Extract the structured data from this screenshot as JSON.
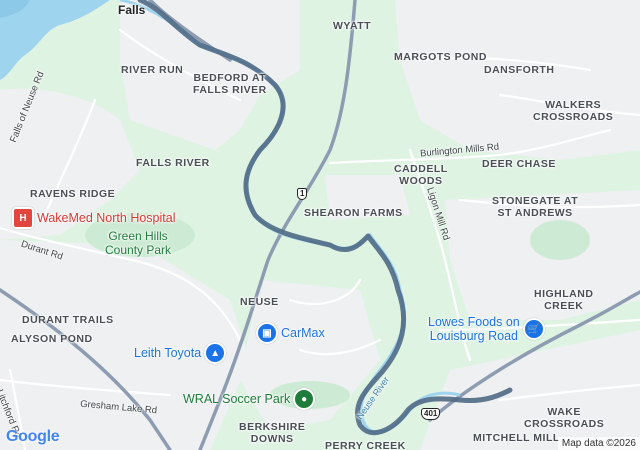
{
  "map": {
    "place_labels": [
      {
        "id": "falls",
        "text": "Falls"
      },
      {
        "id": "wyatt",
        "text": "WYATT"
      },
      {
        "id": "margots-pond",
        "text": "MARGOTS POND"
      },
      {
        "id": "dansforth",
        "text": "DANSFORTH"
      },
      {
        "id": "river-run",
        "text": "RIVER RUN"
      },
      {
        "id": "bedford",
        "text": "BEDFORD AT\nFALLS RIVER"
      },
      {
        "id": "walkers-crossroads",
        "text": "WALKERS\nCROSSROADS"
      },
      {
        "id": "caddell-woods",
        "text": "CADDELL\nWOODS"
      },
      {
        "id": "deer-chase",
        "text": "DEER CHASE"
      },
      {
        "id": "falls-river",
        "text": "FALLS RIVER"
      },
      {
        "id": "ravens-ridge",
        "text": "RAVENS RIDGE"
      },
      {
        "id": "shearon-farms",
        "text": "SHEARON FARMS"
      },
      {
        "id": "stonegate",
        "text": "STONEGATE AT\nST ANDREWS"
      },
      {
        "id": "highland-creek",
        "text": "HIGHLAND\nCREEK"
      },
      {
        "id": "neuse",
        "text": "NEUSE"
      },
      {
        "id": "durant-trails",
        "text": "DURANT TRAILS"
      },
      {
        "id": "alyson-pond",
        "text": "ALYSON POND"
      },
      {
        "id": "berkshire-downs",
        "text": "BERKSHIRE\nDOWNS"
      },
      {
        "id": "perry-creek",
        "text": "PERRY CREEK"
      },
      {
        "id": "wake-crossroads",
        "text": "WAKE\nCROSSROADS"
      },
      {
        "id": "mitchell-mill",
        "text": "MITCHELL MILL"
      }
    ],
    "road_labels": [
      {
        "id": "falls-of-neuse",
        "text": "Falls of Neuse Rd"
      },
      {
        "id": "burlington-mills",
        "text": "Burlington Mills Rd"
      },
      {
        "id": "ligon-mill",
        "text": "Ligon Mill Rd"
      },
      {
        "id": "durant",
        "text": "Durant Rd"
      },
      {
        "id": "gresham-lake",
        "text": "Gresham Lake Rd"
      },
      {
        "id": "litchford",
        "text": "Litchford Rd"
      }
    ],
    "water_labels": [
      {
        "id": "neuse-river",
        "text": "Neuse River"
      }
    ],
    "park_labels": [
      {
        "id": "green-hills",
        "text": "Green Hills\nCounty Park"
      }
    ],
    "route_shields": [
      {
        "id": "us1",
        "text": "1"
      },
      {
        "id": "us401",
        "text": "401"
      }
    ],
    "pois": [
      {
        "id": "wakemed",
        "text": "WakeMed North Hospital",
        "icon": "hospital-icon",
        "color": "#e2463f"
      },
      {
        "id": "carmax",
        "text": "CarMax",
        "icon": "shopping-bag-icon",
        "color": "#1a73e8"
      },
      {
        "id": "leith-toyota",
        "text": "Leith Toyota",
        "icon": "car-dealer-icon",
        "color": "#1a73e8"
      },
      {
        "id": "lowes-foods",
        "text": "Lowes Foods on\nLouisburg Road",
        "icon": "shopping-cart-icon",
        "color": "#1a73e8"
      },
      {
        "id": "wral-soccer-park",
        "text": "WRAL Soccer Park",
        "icon": "park-icon",
        "color": "#1e7d3a"
      }
    ],
    "google_logo": "Google",
    "attribution": "Map data ©2026",
    "colors": {
      "land": "#dff3e3",
      "urban": "#eef0f2",
      "water": "#9fd4ee",
      "route": "#57748f",
      "highway": "#8d9cb0"
    }
  }
}
